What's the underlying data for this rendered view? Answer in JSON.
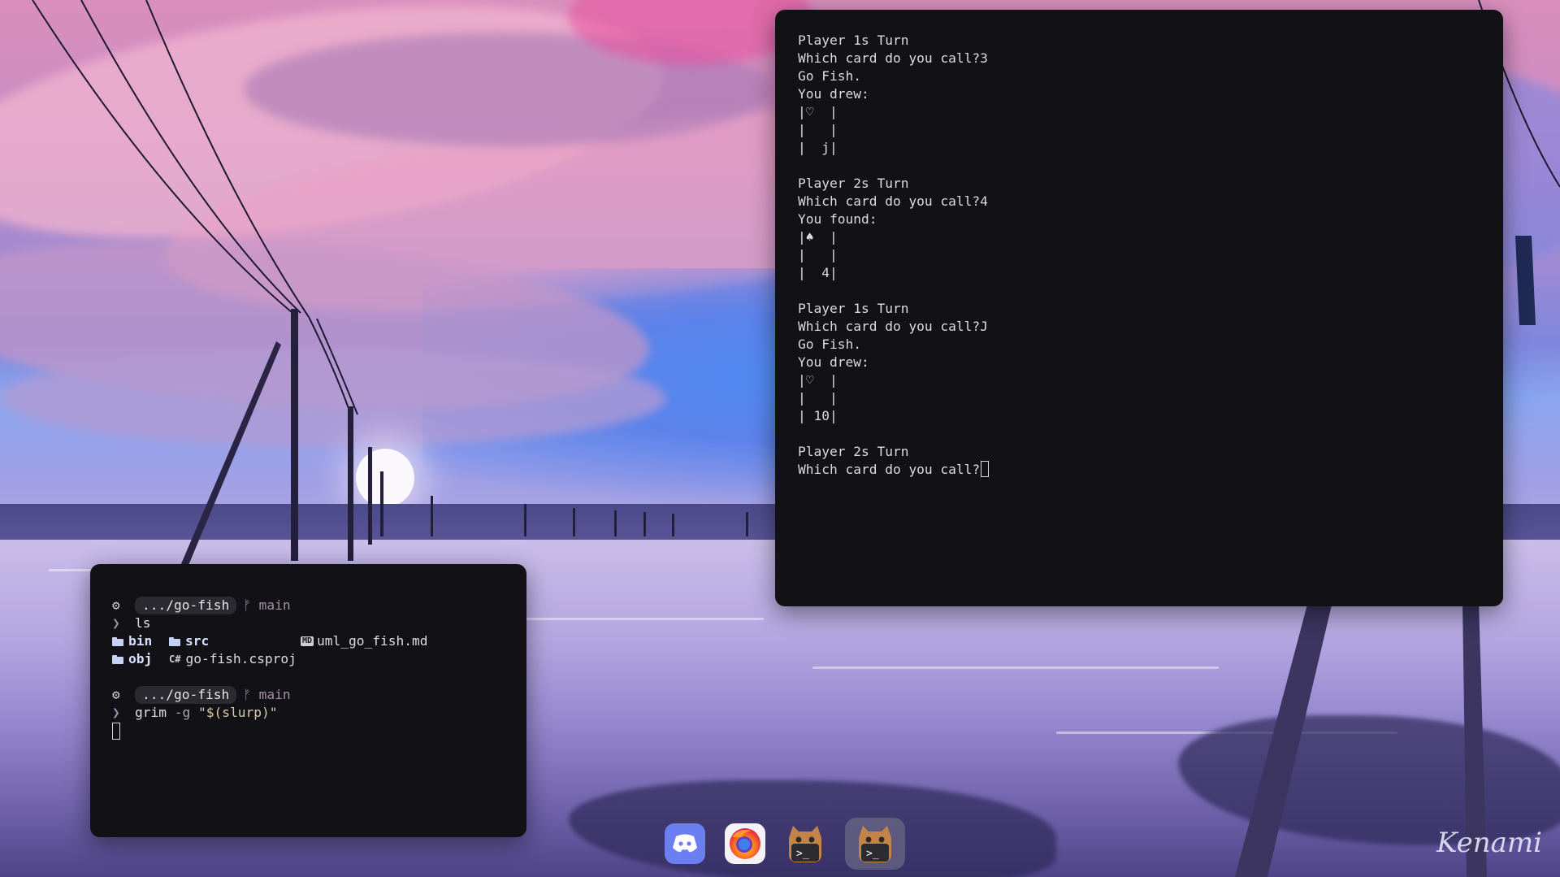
{
  "wallpaper": {
    "signature": "Kenami"
  },
  "terminal_main": {
    "lines": [
      "Player 1s Turn",
      "Which card do you call?3",
      "Go Fish.",
      "You drew:",
      "|♡  |",
      "|   |",
      "|  j|",
      "",
      "Player 2s Turn",
      "Which card do you call?4",
      "You found:",
      "|♠  |",
      "|   |",
      "|  4|",
      "",
      "Player 1s Turn",
      "Which card do you call?J",
      "Go Fish.",
      "You drew:",
      "|♡  |",
      "|   |",
      "| 10|",
      "",
      "Player 2s Turn",
      "Which card do you call?"
    ]
  },
  "terminal_small": {
    "prompt_path": ".../go-fish",
    "branch_icon": "ᚠ",
    "branch": "main",
    "prompt_char": "❯",
    "cmd1": "ls",
    "ls": {
      "bin": "bin",
      "src": "src",
      "uml": "uml_go_fish.md",
      "obj": "obj",
      "csproj": "go-fish.csproj",
      "md_icon_text": "MD",
      "cs_icon_text": "C#"
    },
    "cmd2_name": "grim",
    "cmd2_flag": "-g",
    "cmd2_arg": "\"$(slurp)\""
  },
  "dock": {
    "items": [
      {
        "name": "discord",
        "icon": "discord-icon"
      },
      {
        "name": "firefox",
        "icon": "firefox-icon"
      },
      {
        "name": "kitty",
        "icon": "kitty-terminal-icon"
      },
      {
        "name": "kitty-active",
        "icon": "kitty-terminal-icon"
      }
    ],
    "kitty_glyph": ">_"
  },
  "colors": {
    "terminal_bg": "#121216",
    "dock_active": "#787890"
  }
}
